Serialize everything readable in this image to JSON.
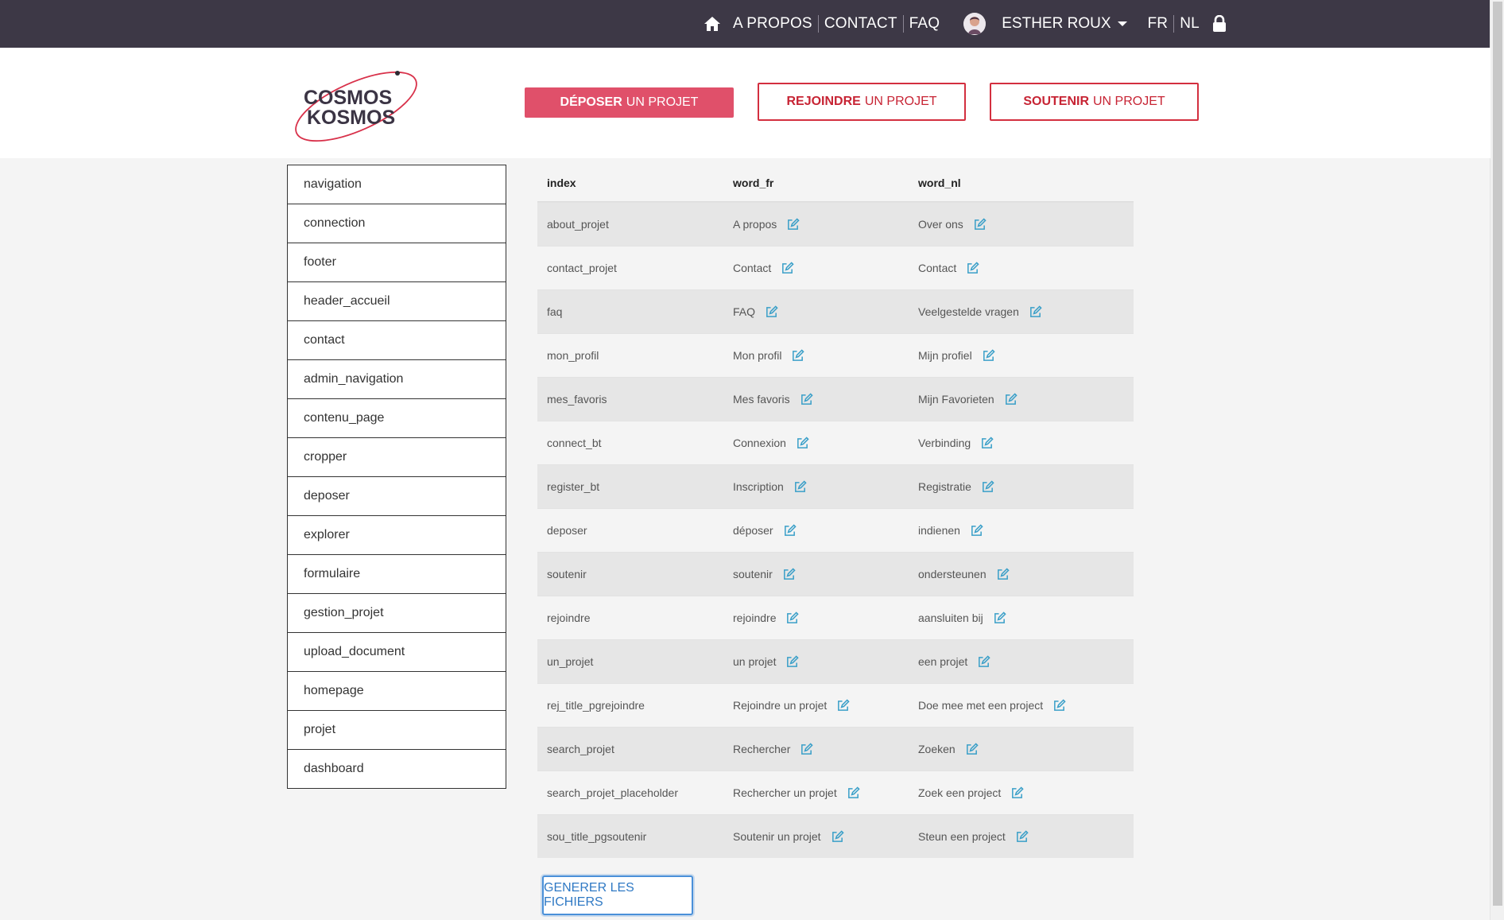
{
  "nav": {
    "about": "A PROPOS",
    "contact": "CONTACT",
    "faq": "FAQ",
    "user_name": "ESTHER ROUX",
    "lang_fr": "FR",
    "lang_nl": "NL"
  },
  "logo": {
    "line1": "COSMOS",
    "line2": "KOSMOS"
  },
  "actions": {
    "deposer": {
      "strong": "DÉPOSER",
      "rest": "UN PROJET"
    },
    "rejoindre": {
      "strong": "REJOINDRE",
      "rest": "UN PROJET"
    },
    "soutenir": {
      "strong": "SOUTENIR",
      "rest": "UN PROJET"
    }
  },
  "sidebar": {
    "items": [
      "navigation",
      "connection",
      "footer",
      "header_accueil",
      "contact",
      "admin_navigation",
      "contenu_page",
      "cropper",
      "deposer",
      "explorer",
      "formulaire",
      "gestion_projet",
      "upload_document",
      "homepage",
      "projet",
      "dashboard"
    ]
  },
  "table": {
    "headers": {
      "index": "index",
      "word_fr": "word_fr",
      "word_nl": "word_nl"
    },
    "rows": [
      {
        "index": "about_projet",
        "fr": "A propos",
        "nl": "Over ons"
      },
      {
        "index": "contact_projet",
        "fr": "Contact",
        "nl": "Contact"
      },
      {
        "index": "faq",
        "fr": "FAQ",
        "nl": "Veelgestelde vragen"
      },
      {
        "index": "mon_profil",
        "fr": "Mon profil",
        "nl": "Mijn profiel"
      },
      {
        "index": "mes_favoris",
        "fr": "Mes favoris",
        "nl": "Mijn Favorieten"
      },
      {
        "index": "connect_bt",
        "fr": "Connexion",
        "nl": "Verbinding"
      },
      {
        "index": "register_bt",
        "fr": "Inscription",
        "nl": "Registratie"
      },
      {
        "index": "deposer",
        "fr": "déposer",
        "nl": "indienen"
      },
      {
        "index": "soutenir",
        "fr": "soutenir",
        "nl": "ondersteunen"
      },
      {
        "index": "rejoindre",
        "fr": "rejoindre",
        "nl": "aansluiten bij"
      },
      {
        "index": "un_projet",
        "fr": "un projet",
        "nl": "een projet"
      },
      {
        "index": "rej_title_pgrejoindre",
        "fr": "Rejoindre un projet",
        "nl": "Doe mee met een project"
      },
      {
        "index": "search_projet",
        "fr": "Rechercher",
        "nl": "Zoeken"
      },
      {
        "index": "search_projet_placeholder",
        "fr": "Rechercher un projet",
        "nl": "Zoek een project"
      },
      {
        "index": "sou_title_pgsoutenir",
        "fr": "Soutenir un projet",
        "nl": "Steun een project"
      }
    ]
  },
  "footer_button": "GENERER LES FICHIERS",
  "colors": {
    "topbar": "#3d3846",
    "accent_red": "#e0506a",
    "edit_icon": "#3a9fc8",
    "generer_border": "#4a90d9"
  },
  "icons": {
    "home": "home-icon",
    "lock": "lock-icon",
    "edit": "edit-icon",
    "caret": "caret-down-icon"
  }
}
